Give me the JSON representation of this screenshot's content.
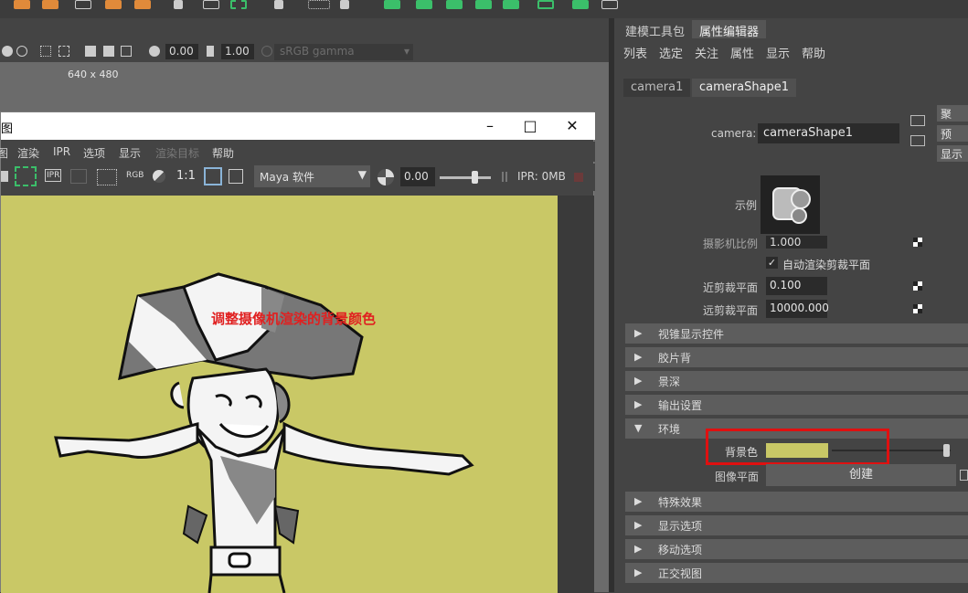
{
  "viewport": {
    "exposure": "0.00",
    "gamma": "1.00",
    "color_space": "sRGB gamma",
    "resolution": "640 x 480"
  },
  "render_window": {
    "title_fragment": "图",
    "menus": [
      "图",
      "渲染",
      "IPR",
      "选项",
      "显示",
      "渲染目标",
      "帮助"
    ],
    "ratio": "1:1",
    "renderer": "Maya 软件",
    "exposure": "0.00",
    "ipr_status": "IPR: 0MB",
    "rgb_label": "RGB",
    "ipr_icon_label": "IPR",
    "annotation": "调整摄像机渲染的背景颜色",
    "canvas_color": "#c9c866"
  },
  "attribute_editor": {
    "tabs": [
      "建模工具包",
      "属性编辑器"
    ],
    "menus": [
      "列表",
      "选定",
      "关注",
      "属性",
      "显示",
      "帮助"
    ],
    "node_tabs": [
      "camera1",
      "cameraShape1"
    ],
    "side_buttons": [
      "聚",
      "预",
      "显示"
    ],
    "camera_label": "camera:",
    "camera_value": "cameraShape1",
    "sample_label": "示例",
    "cut_label": "摄影机比例",
    "cut_value": "1.000",
    "auto_clip_label": "自动渲染剪裁平面",
    "near_clip_label": "近剪裁平面",
    "near_clip_value": "0.100",
    "far_clip_label": "远剪裁平面",
    "far_clip_value": "10000.000",
    "sections": [
      "视锥显示控件",
      "胶片背",
      "景深",
      "输出设置",
      "环境",
      "特殊效果",
      "显示选项",
      "移动选项",
      "正交视图"
    ],
    "background_color_label": "背景色",
    "background_color": "#c9c866",
    "image_plane_label": "图像平面",
    "create_label": "创建"
  }
}
